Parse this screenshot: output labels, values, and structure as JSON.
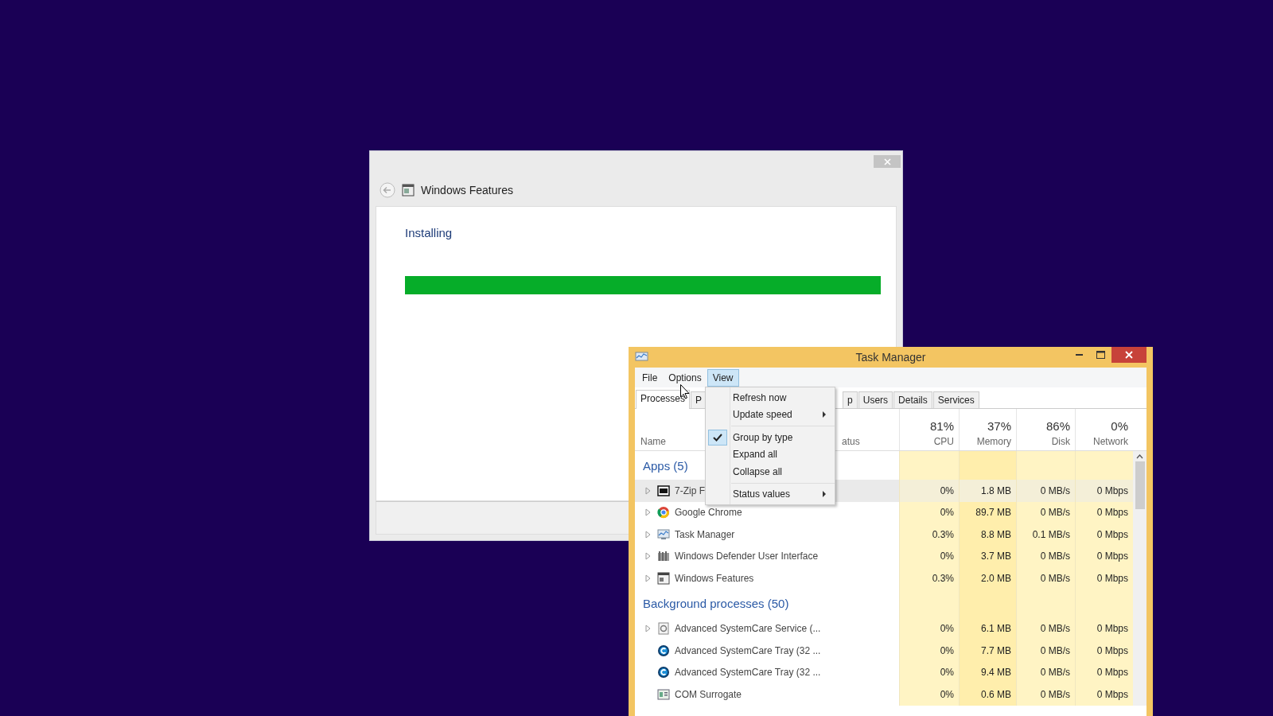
{
  "features_window": {
    "title": "Windows Features",
    "status": "Installing",
    "progress": {
      "level": 1
    }
  },
  "task_manager": {
    "title": "Task Manager",
    "menu_bar": [
      {
        "label": "File",
        "selected": false
      },
      {
        "label": "Options",
        "selected": false
      },
      {
        "label": "View",
        "selected": true
      }
    ],
    "tabs": [
      {
        "label": "Processes",
        "selected": true
      },
      {
        "label": "P",
        "selected": false
      },
      {
        "label": "p",
        "selected": false
      },
      {
        "label": "Users",
        "selected": false
      },
      {
        "label": "Details",
        "selected": false
      },
      {
        "label": "Services",
        "selected": false
      }
    ],
    "columns": {
      "name": "Name",
      "status": "atus",
      "cpu": {
        "percent": "81%",
        "label": "CPU"
      },
      "memory": {
        "percent": "37%",
        "label": "Memory"
      },
      "disk": {
        "percent": "86%",
        "label": "Disk"
      },
      "network": {
        "percent": "0%",
        "label": "Network"
      }
    },
    "groups": [
      {
        "title": "Apps (5)",
        "rows": [
          {
            "name": "7-Zip F",
            "cpu": "0%",
            "memory": "1.8 MB",
            "disk": "0 MB/s",
            "network": "0 Mbps",
            "expandable": true,
            "highlighted": true
          },
          {
            "name": "Google Chrome",
            "cpu": "0%",
            "memory": "89.7 MB",
            "disk": "0 MB/s",
            "network": "0 Mbps",
            "expandable": true,
            "highlighted": false
          },
          {
            "name": "Task Manager",
            "cpu": "0.3%",
            "memory": "8.8 MB",
            "disk": "0.1 MB/s",
            "network": "0 Mbps",
            "expandable": true,
            "highlighted": false
          },
          {
            "name": "Windows Defender User Interface",
            "cpu": "0%",
            "memory": "3.7 MB",
            "disk": "0 MB/s",
            "network": "0 Mbps",
            "expandable": true,
            "highlighted": false
          },
          {
            "name": "Windows Features",
            "cpu": "0.3%",
            "memory": "2.0 MB",
            "disk": "0 MB/s",
            "network": "0 Mbps",
            "expandable": true,
            "highlighted": false
          }
        ]
      },
      {
        "title": "Background processes (50)",
        "rows": [
          {
            "name": "Advanced SystemCare Service (...",
            "cpu": "0%",
            "memory": "6.1 MB",
            "disk": "0 MB/s",
            "network": "0 Mbps",
            "expandable": true,
            "highlighted": false
          },
          {
            "name": "Advanced SystemCare Tray (32 ...",
            "cpu": "0%",
            "memory": "7.7 MB",
            "disk": "0 MB/s",
            "network": "0 Mbps",
            "expandable": false,
            "highlighted": false
          },
          {
            "name": "Advanced SystemCare Tray (32 ...",
            "cpu": "0%",
            "memory": "9.4 MB",
            "disk": "0 MB/s",
            "network": "0 Mbps",
            "expandable": false,
            "highlighted": false
          },
          {
            "name": "COM Surrogate",
            "cpu": "0%",
            "memory": "0.6 MB",
            "disk": "0 MB/s",
            "network": "0 Mbps",
            "expandable": false,
            "highlighted": false
          }
        ]
      }
    ],
    "view_menu": [
      {
        "kind": "item",
        "label": "Refresh now",
        "checked": false
      },
      {
        "kind": "submenu",
        "label": "Update speed",
        "checked": false
      },
      {
        "kind": "separator"
      },
      {
        "kind": "item",
        "label": "Group by type",
        "checked": true
      },
      {
        "kind": "item",
        "label": "Expand all",
        "checked": false
      },
      {
        "kind": "item",
        "label": "Collapse all",
        "checked": false
      },
      {
        "kind": "separator"
      },
      {
        "kind": "submenu",
        "label": "Status values",
        "checked": false
      }
    ]
  }
}
